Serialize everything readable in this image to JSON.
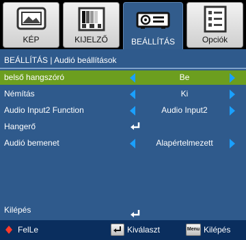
{
  "tabs": [
    {
      "label": "KÉP",
      "icon": "picture-icon"
    },
    {
      "label": "KIJELZŐ",
      "icon": "display-icon"
    },
    {
      "label": "BEÁLLÍTÁS",
      "icon": "projector-icon"
    },
    {
      "label": "Opciók",
      "icon": "options-icon"
    }
  ],
  "panel": {
    "title": "BEÁLLÍTÁS  | Audió beállítások",
    "rows": [
      {
        "name": "belső hangszóró",
        "value": "Be",
        "selected": true
      },
      {
        "name": "Némítás",
        "value": "Ki"
      },
      {
        "name": "Audio Input2 Function",
        "value": "Audio Input2"
      },
      {
        "name": "Hangerő",
        "value": ""
      },
      {
        "name": "Audió bemenet",
        "value": "Alapértelmezett"
      }
    ],
    "exit_label": "Kilépés"
  },
  "footer": {
    "nav_label": "FelLe",
    "select_label": "Kiválaszt",
    "menu_key": "Menu",
    "exit_label": "Kilépés"
  },
  "colors": {
    "panel": "#2f5a8c",
    "selection": "#6c9e1f",
    "arrow": "#1aa0ff",
    "footer": "#0a2e5e"
  }
}
